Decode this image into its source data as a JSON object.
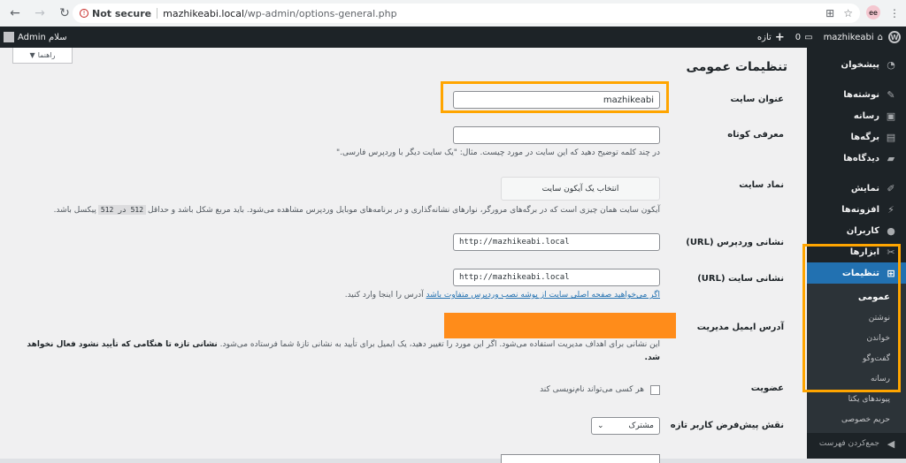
{
  "browser": {
    "not_secure": "Not secure",
    "url_host": "mazhikeabi.local",
    "url_path": "/wp-admin/options-general.php",
    "avatar": "ee"
  },
  "adminbar": {
    "site_name": "mazhikeabi",
    "comments_count": "0",
    "new_label": "تازه",
    "greeting": "سلام Admin"
  },
  "sidebar": {
    "items": [
      {
        "label": "پیشخوان",
        "icon": "dashboard-icon"
      },
      {
        "label": "نوشته‌ها",
        "icon": "pin-icon"
      },
      {
        "label": "رسانه",
        "icon": "media-icon"
      },
      {
        "label": "برگه‌ها",
        "icon": "pages-icon"
      },
      {
        "label": "دیدگاه‌ها",
        "icon": "comments-icon"
      },
      {
        "label": "نمایش",
        "icon": "brush-icon"
      },
      {
        "label": "افزونه‌ها",
        "icon": "plugin-icon"
      },
      {
        "label": "کاربران",
        "icon": "users-icon"
      },
      {
        "label": "ابزارها",
        "icon": "tools-icon"
      },
      {
        "label": "تنظیمات",
        "icon": "settings-icon"
      }
    ],
    "submenu": [
      "عمومی",
      "نوشتن",
      "خواندن",
      "گفت‌وگو",
      "رسانه",
      "پیوندهای یکتا",
      "حریم خصوصی"
    ],
    "collapse_label": "جمع‌کردن فهرست"
  },
  "page": {
    "help_label": "راهنما",
    "title": "تنظیمات عمومی",
    "site_title_label": "عنوان سایت",
    "site_title_value": "mazhikeabi",
    "tagline_label": "معرفی کوتاه",
    "tagline_value": "",
    "tagline_desc": "در چند کلمه توضیح دهید که این سایت در مورد چیست. مثال: \"یک سایت دیگر با وردپرس فارسی.\"",
    "site_icon_label": "نماد سایت",
    "site_icon_button": "انتخاب یک آیکون سایت",
    "site_icon_desc_1": "آیکون سایت همان چیزی است که در برگه‌های مرورگر، نوارهای نشانه‌گذاری و در برنامه‌های موبایل وردپرس مشاهده می‌شود. باید مربع شکل باشد و حداقل",
    "site_icon_code": "512 در 512",
    "site_icon_desc_2": "پیکسل باشد.",
    "wp_url_label": "نشانی وردپرس (URL)",
    "wp_url_value": "http://mazhikeabi.local",
    "site_url_label": "نشانی سایت (URL)",
    "site_url_value": "http://mazhikeabi.local",
    "site_url_link": "اگر می‌خواهید صفحه اصلی سایت از پوشه نصب وردپرس متفاوت باشد",
    "site_url_desc": "آدرس را اینجا وارد کنید.",
    "admin_email_label": "آدرس ایمیل مدیریت",
    "admin_email_desc": "این نشانی برای اهداف مدیریت استفاده می‌شود. اگر این مورد را تغییر دهید، یک ایمیل برای تأیید به نشانی تازهٔ شما فرستاده می‌شود.",
    "admin_email_desc_bold": "نشانی تازه تا هنگامی که تأیید نشود فعال نخواهد شد.",
    "membership_label": "عضویت",
    "membership_checkbox": "هر کسی می‌تواند نام‌نویسی کند",
    "default_role_label": "نقش پیش‌فرض کاربر تازه",
    "default_role_value": "مشترک"
  },
  "colors": {
    "highlight": "#ffa500",
    "redaction": "#ff8c1a",
    "accent": "#2271b1"
  }
}
